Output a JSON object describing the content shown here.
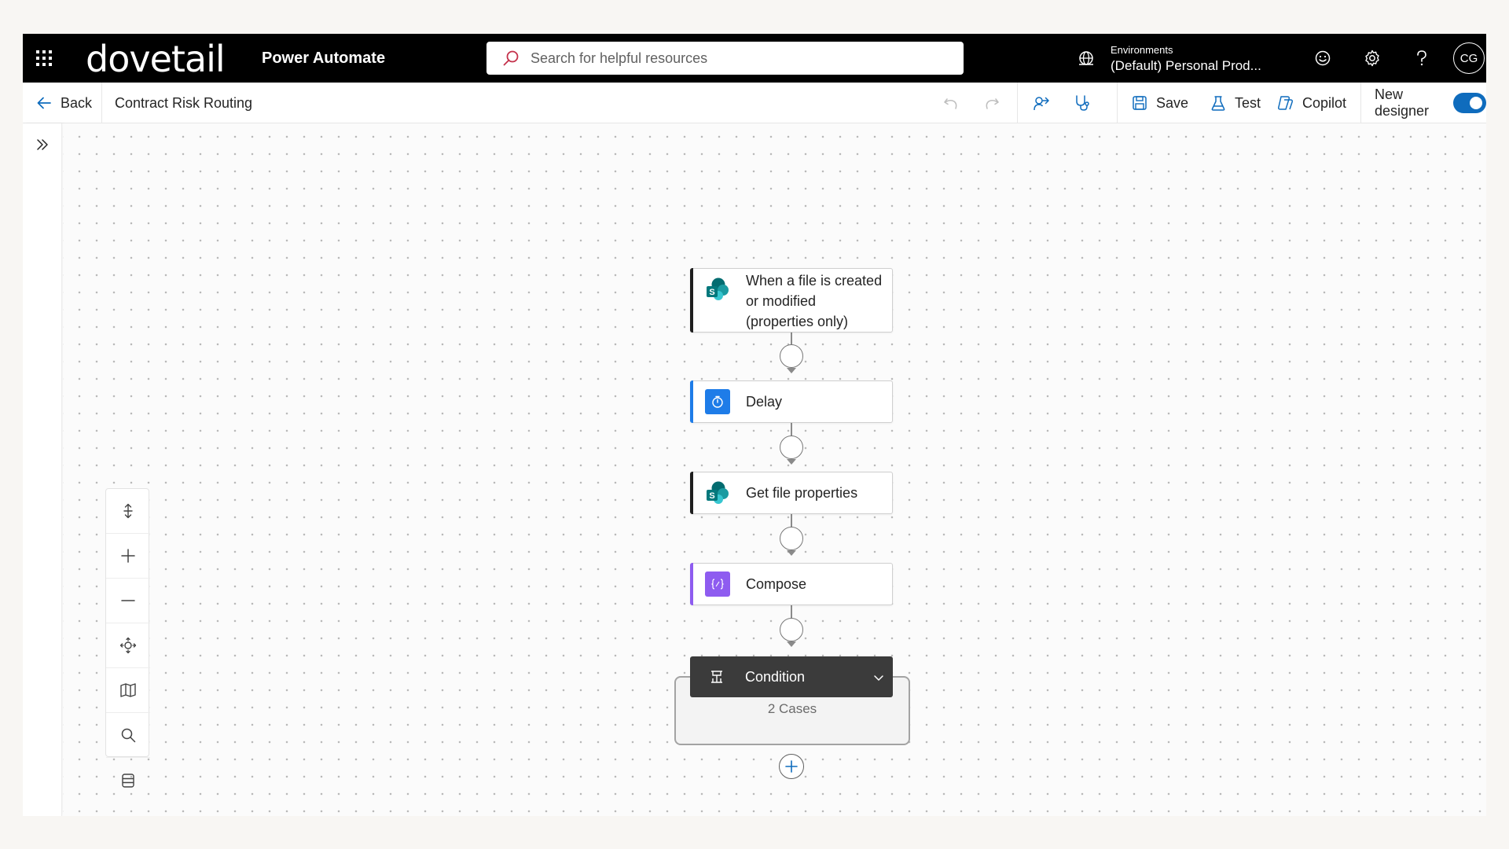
{
  "topbar": {
    "logo": "dovetail",
    "app_name": "Power Automate",
    "search_placeholder": "Search for helpful resources",
    "environment_label": "Environments",
    "environment_value": "(Default) Personal Prod...",
    "avatar_initials": "CG"
  },
  "commandbar": {
    "back_label": "Back",
    "flow_name": "Contract Risk Routing",
    "save_label": "Save",
    "test_label": "Test",
    "copilot_label": "Copilot",
    "new_designer_label": "New designer",
    "new_designer_enabled": true
  },
  "flow": {
    "trigger": {
      "lines": [
        "When a file is created",
        "or modified",
        "(properties only)"
      ],
      "accent": "#1f1f1f"
    },
    "steps": [
      {
        "label": "Delay",
        "accent": "#1e7ce8"
      },
      {
        "label": "Get file properties",
        "accent": "#1f1f1f"
      },
      {
        "label": "Compose",
        "accent": "#8e5cf0"
      }
    ],
    "condition": {
      "label": "Condition",
      "cases": "2 Cases"
    }
  },
  "colors": {
    "brand_blue": "#0f6cbd",
    "topbar_bg": "#000000",
    "condition_bg": "#3b3b3b"
  }
}
